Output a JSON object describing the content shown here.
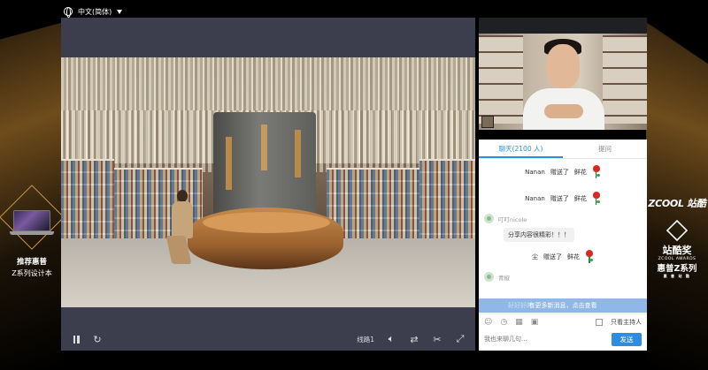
{
  "language": {
    "label": "中文(简体)"
  },
  "promo": {
    "line1": "推荐惠普",
    "line2": "Z系列设计本"
  },
  "brands": {
    "zcool": "ZCOOL 站酷",
    "awards_cn": "站酷奖",
    "awards_en": "ZCOOL AWARDS",
    "zseries": "惠普Z系列",
    "zseries_sub": "惠 普 站 酷"
  },
  "player": {
    "line_label": "线路1",
    "icons": [
      "pause-icon",
      "refresh-icon",
      "volume-icon",
      "switch-icon",
      "clip-icon",
      "fullscreen-icon"
    ]
  },
  "chat": {
    "tabs": [
      {
        "label": "聊天(2100 人)",
        "active": true
      },
      {
        "label": "提问",
        "active": false
      }
    ],
    "gifts": [
      {
        "user": "Nanan",
        "text": "赠送了",
        "item": "鲜花"
      },
      {
        "user": "Nanan",
        "text": "赠送了",
        "item": "鲜花"
      }
    ],
    "messages": [
      {
        "user": "叮叮nicole",
        "text": "分享内容很精彩！！！"
      }
    ],
    "gift3": {
      "user": "尘",
      "text": "赠送了",
      "item": "鲜花"
    },
    "user2": {
      "user": "青椒"
    },
    "banner": {
      "faded": "好好好的",
      "text": "有更多新消息，点击查看"
    },
    "only_host": "只看主持人",
    "input_placeholder": "我也来聊几句...",
    "send": "发送"
  },
  "colors": {
    "accent": "#2e8de0",
    "player_bg": "#3c3d4d",
    "rose": "#d92a22"
  }
}
